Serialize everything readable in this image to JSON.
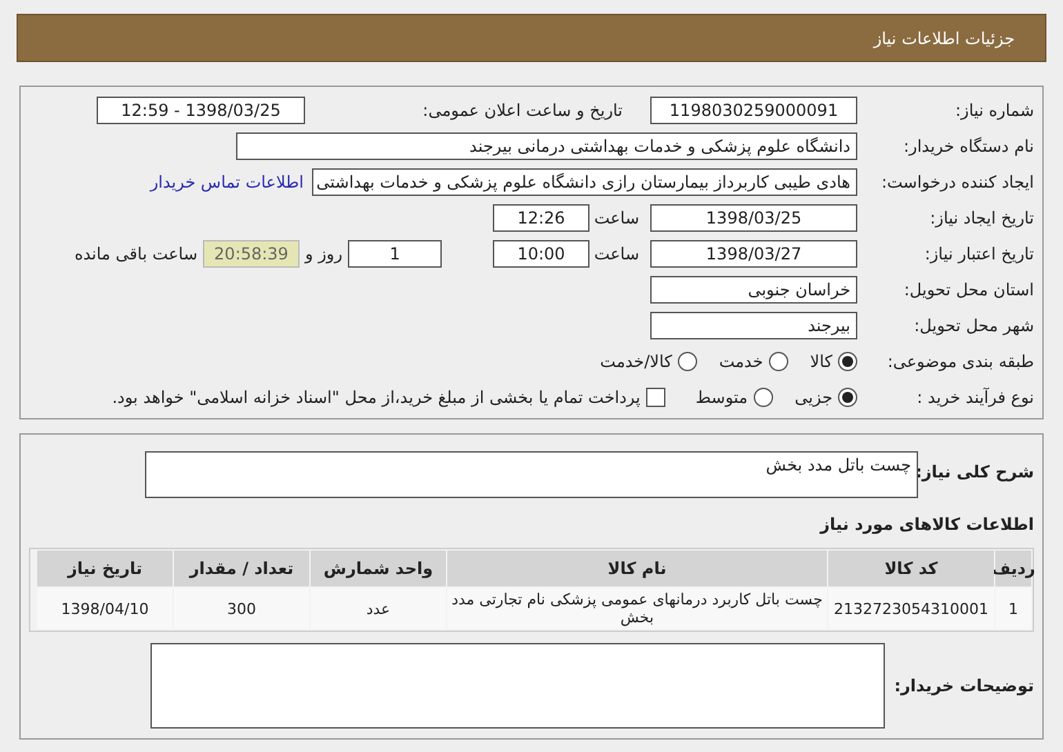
{
  "header": {
    "title": "جزئیات اطلاعات نیاز"
  },
  "details": {
    "need_number": {
      "label": "شماره نیاز:",
      "value": "1198030259000091"
    },
    "announce": {
      "label": "تاریخ و ساعت اعلان عمومی:",
      "value": "1398/03/25 - 12:59"
    },
    "buyer": {
      "label": "نام دستگاه خریدار:",
      "value": "دانشگاه علوم پزشکی و خدمات بهداشتی درمانی بیرجند"
    },
    "requester": {
      "label": "ایجاد کننده درخواست:",
      "value": "هادی طیبی کاربرداز بیمارستان رازی دانشگاه علوم پزشکی و خدمات بهداشتی",
      "link": "اطلاعات تماس خریدار"
    },
    "created": {
      "label": "تاریخ ایجاد نیاز:",
      "date": "1398/03/25",
      "time_label": "ساعت",
      "time": "12:26"
    },
    "valid": {
      "label": "تاریخ اعتبار نیاز:",
      "date": "1398/03/27",
      "time_label": "ساعت",
      "time": "10:00",
      "days": "1",
      "days_label": "روز و",
      "remaining": "20:58:39",
      "remaining_label": "ساعت باقی مانده"
    },
    "province": {
      "label": "استان محل تحویل:",
      "value": "خراسان جنوبی"
    },
    "city": {
      "label": "شهر محل تحویل:",
      "value": "بیرجند"
    },
    "category": {
      "label": "طبقه بندی موضوعی:",
      "options": [
        {
          "label": "کالا",
          "selected": true
        },
        {
          "label": "خدمت",
          "selected": false
        },
        {
          "label": "کالا/خدمت",
          "selected": false
        }
      ]
    },
    "process": {
      "label": "نوع فرآیند خرید :",
      "options": [
        {
          "label": "جزیی",
          "selected": true
        },
        {
          "label": "متوسط",
          "selected": false
        }
      ],
      "payment": {
        "label": "پرداخت تمام یا بخشی از مبلغ خرید،از محل \"اسناد خزانه اسلامی\" خواهد بود.",
        "checked": false
      }
    }
  },
  "summary": {
    "label": "شرح کلی نیاز:",
    "value": "چست باتل مدد بخش"
  },
  "goods": {
    "title": "اطلاعات کالاهای مورد نیاز",
    "columns": [
      "ردیف",
      "کد کالا",
      "نام کالا",
      "واحد شمارش",
      "تعداد / مقدار",
      "تاریخ نیاز"
    ],
    "rows": [
      [
        "1",
        "2132723054310001",
        "چست باتل کاربرد درمانهای عمومی پزشکی نام تجارتی مدد بخش",
        "عدد",
        "300",
        "1398/04/10"
      ]
    ]
  },
  "notes": {
    "label": "توضیحات خریدار:"
  }
}
